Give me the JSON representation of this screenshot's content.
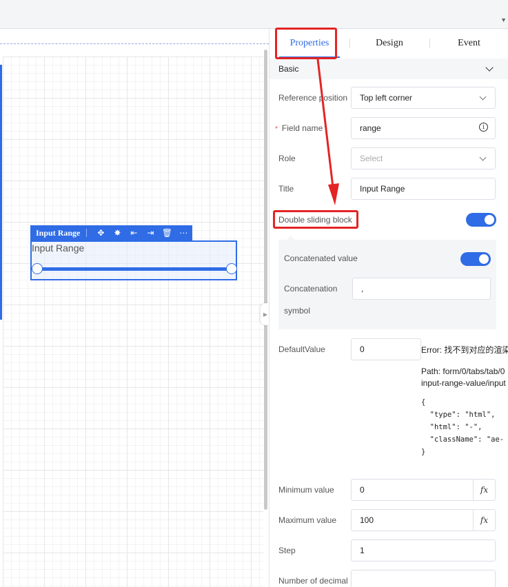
{
  "tabs": [
    "Properties",
    "Design",
    "Event"
  ],
  "section": {
    "title": "Basic"
  },
  "fields": {
    "reference_position": {
      "label": "Reference position",
      "value": "Top left corner"
    },
    "field_name": {
      "required_mark": "*",
      "label": "Field name",
      "value": "range"
    },
    "role": {
      "label": "Role",
      "placeholder": "Select"
    },
    "title": {
      "label": "Title",
      "value": "Input Range"
    },
    "double_sliding_block": {
      "label": "Double sliding block",
      "enabled": true
    },
    "concatenated_value": {
      "label": "Concatenated value",
      "enabled": true
    },
    "concatenation_symbol": {
      "label_line1": "Concatenation",
      "label_line2": "symbol",
      "value": ","
    },
    "default_value": {
      "label": "DefaultValue",
      "value": "0"
    },
    "minimum_value": {
      "label": "Minimum value",
      "value": "0",
      "fx": "fx"
    },
    "maximum_value": {
      "label": "Maximum value",
      "value": "100",
      "fx": "fx"
    },
    "step": {
      "label": "Step",
      "value": "1"
    },
    "decimal": {
      "label": "Number of decimal",
      "value": ""
    }
  },
  "error": {
    "line1": "Error: 找不到对应的渲染",
    "line2": "Path: form/0/tabs/tab/0",
    "line3": "input-range-value/input",
    "code": "{\n  \"type\": \"html\",\n  \"html\": \"-\",\n  \"className\": \"ae-\n}"
  },
  "widget": {
    "toolbar_title": "Input Range",
    "label": "Input Range",
    "icons": [
      "move-icon",
      "bug-icon",
      "align-left-icon",
      "align-right-icon",
      "delete-icon",
      "more-icon"
    ],
    "accent": "#2f6ce5"
  },
  "colors": {
    "accent": "#2f6ce5",
    "highlight": "#e32424"
  }
}
